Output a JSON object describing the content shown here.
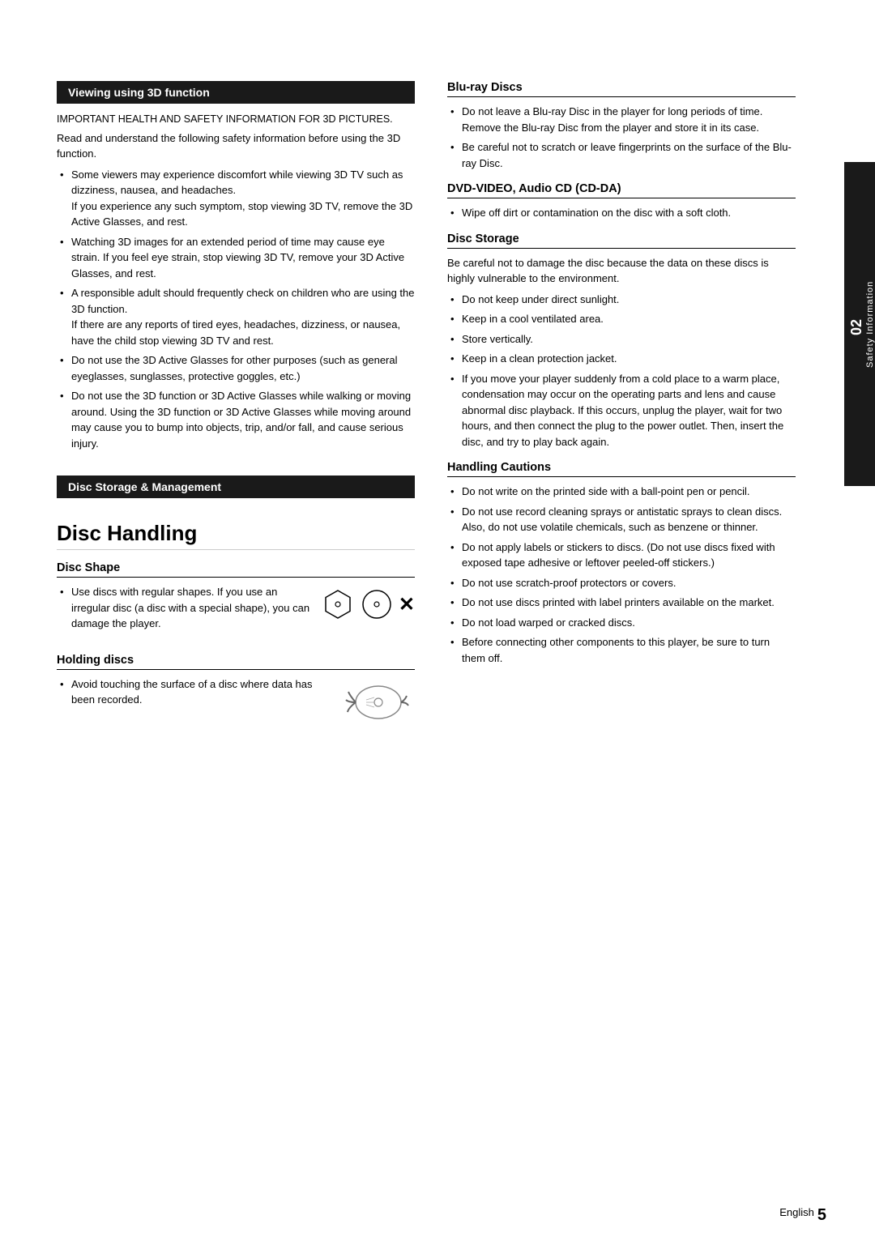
{
  "page": {
    "number": "5",
    "lang": "English"
  },
  "side_tab": {
    "number": "02",
    "label": "Safety Information"
  },
  "section1": {
    "header": "Viewing using 3D function",
    "intro_uppercase": "IMPORTANT HEALTH AND SAFETY INFORMATION FOR 3D PICTURES.",
    "intro_body": "Read and understand the following safety information before using the 3D function.",
    "bullets": [
      "Some viewers may experience discomfort while viewing 3D TV such as dizziness, nausea, and headaches.\nIf you experience any such symptom, stop viewing 3D TV, remove the 3D Active Glasses, and rest.",
      "Watching 3D images for an extended period of time may cause eye strain. If you feel eye strain, stop viewing 3D TV, remove your 3D Active Glasses, and rest.",
      "A responsible adult should frequently check on children who are using the 3D function.\nIf there are any reports of tired eyes, headaches, dizziness, or nausea, have the child stop viewing 3D TV and rest.",
      "Do not use the 3D Active Glasses for other purposes (such as general eyeglasses, sunglasses, protective goggles, etc.)",
      "Do not use the 3D function or 3D Active Glasses while walking or moving around. Using the 3D function or 3D Active Glasses while moving around may cause you to bump into objects, trip, and/or fall, and cause serious injury."
    ]
  },
  "section2": {
    "header": "Disc Storage & Management"
  },
  "disc_handling": {
    "title": "Disc Handling",
    "disc_shape": {
      "label": "Disc Shape",
      "text": "Use discs with regular shapes. If you use an irregular disc (a disc with a special shape), you can damage the player."
    },
    "holding_discs": {
      "label": "Holding discs",
      "text": "Avoid touching the surface of a disc where data has been recorded."
    }
  },
  "right_col": {
    "bluray": {
      "label": "Blu-ray Discs",
      "bullets": [
        "Do not leave a Blu-ray Disc in the player for long periods of time. Remove the Blu-ray Disc from the player and store it in its case.",
        "Be careful not to scratch or leave fingerprints on the surface of the Blu-ray Disc."
      ]
    },
    "dvd": {
      "label": "DVD-VIDEO, Audio CD (CD-DA)",
      "bullets": [
        "Wipe off dirt or contamination on the disc with a soft cloth."
      ]
    },
    "disc_storage": {
      "label": "Disc Storage",
      "intro": "Be careful not to damage the disc because the data on these discs is highly vulnerable to the environment.",
      "bullets": [
        "Do not keep under direct sunlight.",
        "Keep in a cool ventilated area.",
        "Store vertically.",
        "Keep in a clean protection jacket.",
        "If you move your player suddenly from a cold place to a warm place, condensation may occur on the operating parts and lens and cause abnormal disc playback. If this occurs, unplug the player, wait for two hours, and then connect the plug to the power outlet. Then, insert the disc, and try to play back again."
      ]
    },
    "handling_cautions": {
      "label": "Handling Cautions",
      "bullets": [
        "Do not write on the printed side with a ball-point pen or pencil.",
        "Do not use record cleaning sprays or antistatic sprays to clean discs. Also, do not use volatile chemicals, such as benzene or thinner.",
        "Do not apply labels or stickers to discs. (Do not use discs fixed with exposed tape adhesive or leftover peeled-off stickers.)",
        "Do not use scratch-proof protectors or covers.",
        "Do not use discs printed with label printers available on the market.",
        "Do not load warped or cracked discs.",
        "Before connecting other components to this player, be sure to turn them off."
      ]
    }
  }
}
